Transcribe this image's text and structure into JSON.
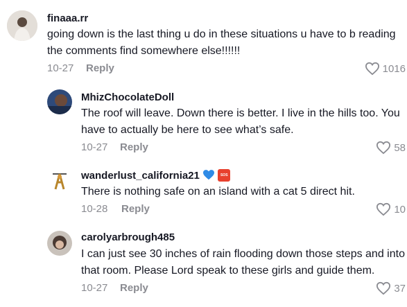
{
  "comments": [
    {
      "username": "finaaa.rr",
      "text": "going down is the last thing u do in these situations u have to b reading the comments find somewhere else!!!!!!",
      "date": "10-27",
      "reply_label": "Reply",
      "likes": "1016"
    },
    {
      "username": "MhizChocolateDoll",
      "text": "The roof will leave. Down there is better. I live in the hills too. You have to actually be here to see what’s safe.",
      "date": "10-27",
      "reply_label": "Reply",
      "likes": "58"
    },
    {
      "username": "wanderlust_california21",
      "badge_icons": [
        "blue-heart-icon",
        "sos-icon"
      ],
      "badge_sos_text": "SOS",
      "text": "There is nothing safe on an island with a cat 5 direct hit.",
      "date": "10-28",
      "reply_label": "Reply",
      "likes": "10"
    },
    {
      "username": "carolyarbrough485",
      "text": "I can just see 30 inches of rain flooding down those steps and into that room. Please Lord speak to these girls and guide them.",
      "date": "10-27",
      "reply_label": "Reply",
      "likes": "37"
    }
  ],
  "colors": {
    "text": "#161823",
    "secondary": "#8a8b91",
    "heart_blue": "#2f8be6",
    "sos_red": "#e8412e"
  },
  "icons": {
    "like": "heart-outline-icon"
  }
}
